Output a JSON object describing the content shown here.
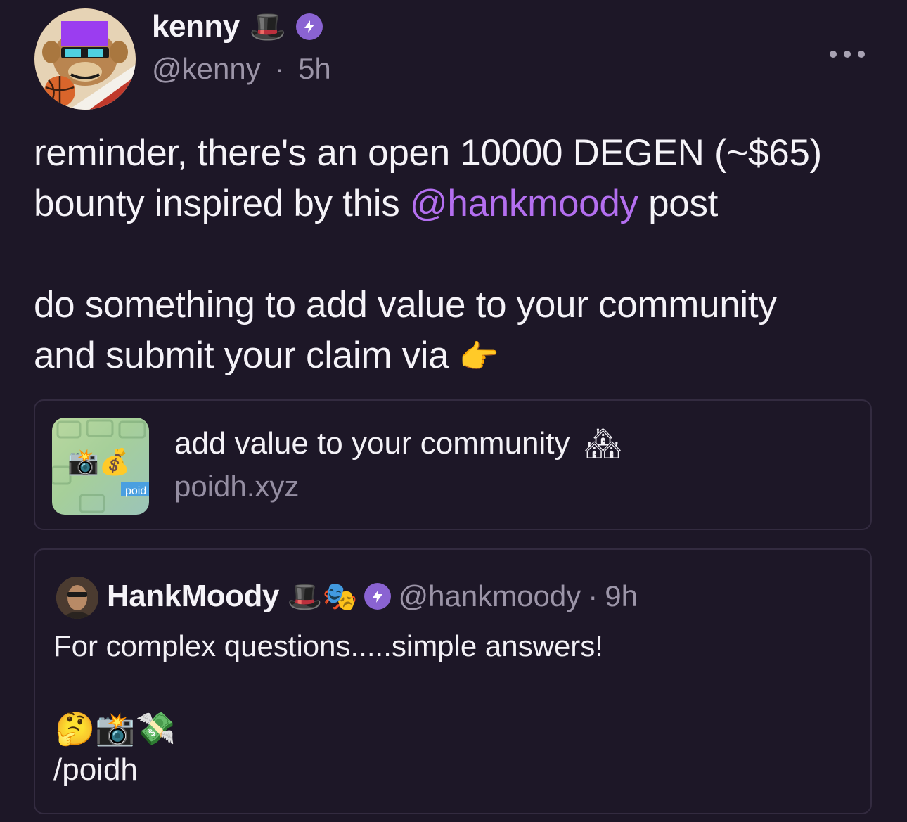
{
  "post": {
    "author": {
      "display_name": "kenny",
      "name_emoji": "🎩",
      "badge_icon": "power-badge-icon",
      "handle": "@kenny",
      "separator": "·",
      "time": "5h"
    },
    "more_icon": "ellipsis-icon",
    "body": {
      "line1": "reminder, there's an open 10000 DEGEN (~$65)",
      "line2_before": "bounty inspired by this ",
      "mention": "@hankmoody",
      "line2_after": " post",
      "line3": "do something to add value to your community",
      "line4": "and submit your claim via ",
      "pointing_emoji": "👉"
    },
    "embed": {
      "title": "add value to your community",
      "title_emoji": "🏘",
      "domain": "poidh.xyz",
      "thumb_emojis": "📸💰",
      "thumb_label": "poid"
    },
    "quote": {
      "display_name": "HankMoody",
      "name_emojis": "🎩🎭",
      "badge_icon": "power-badge-icon",
      "handle": "@hankmoody",
      "separator": "·",
      "time": "9h",
      "text": "For complex questions.....simple answers!",
      "emoji_line": "🤔📸💸",
      "command": "/poidh"
    },
    "colors": {
      "background": "#1d1727",
      "mention": "#b46ff0",
      "badge": "#8a63d2",
      "muted_text": "#9c95a8",
      "card_border": "#332b40"
    }
  }
}
